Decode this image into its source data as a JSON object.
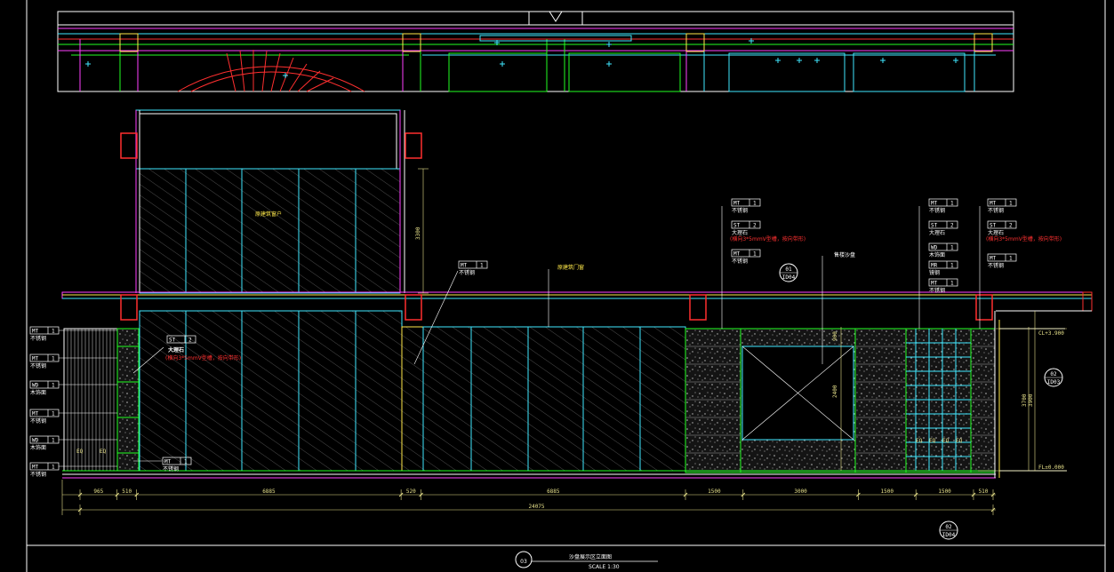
{
  "colors": {
    "background": "#000000",
    "frame": "#ffffff",
    "wall": "#ff2f2f",
    "magenta": "#ff3fff",
    "cyan": "#3fe8ff",
    "green": "#22ff22",
    "yellow": "#ffe94a",
    "dimension": "#e6e08a",
    "glass_hatch": "#6a6a6a"
  },
  "title_block": {
    "number": "03",
    "title": "沙盘展示区立面图",
    "scale": "SCALE 1:30"
  },
  "labels": {
    "window": "原建筑窗户",
    "door": "原建筑门窗",
    "sand_table": "售楼沙盘",
    "marble_bold": "大理石",
    "glass_note": "(横向3*5mmV型槽，按向带形)"
  },
  "tags_left": [
    {
      "code": "MT",
      "num": "1",
      "desc": "不锈钢"
    },
    {
      "code": "MT",
      "num": "1",
      "desc": "不锈钢"
    },
    {
      "code": "WD",
      "num": "1",
      "desc": "木饰面"
    },
    {
      "code": "MT",
      "num": "1",
      "desc": "不锈钢"
    },
    {
      "code": "WD",
      "num": "1",
      "desc": "木饰面"
    },
    {
      "code": "MT",
      "num": "1",
      "desc": "不锈钢"
    }
  ],
  "tag_st_left": {
    "code": "ST",
    "num": "2"
  },
  "tag_mid_top": {
    "code": "MT",
    "num": "1",
    "desc": "不锈钢"
  },
  "tag_mid_bottom": {
    "code": "MT",
    "num": "1",
    "desc": "不锈钢"
  },
  "tags_right_a": [
    {
      "code": "MT",
      "num": "1",
      "desc": "不锈钢"
    },
    {
      "code": "ST",
      "num": "2",
      "desc": "大理石",
      "note": "(横向3*5mmV型槽，按向带形)"
    },
    {
      "code": "MT",
      "num": "1",
      "desc": "不锈钢"
    }
  ],
  "tags_right_b": [
    {
      "code": "MT",
      "num": "1",
      "desc": "不锈钢"
    },
    {
      "code": "ST",
      "num": "2",
      "desc": "大理石"
    },
    {
      "code": "WD",
      "num": "1",
      "desc": "木饰面"
    },
    {
      "code": "MR",
      "num": "1",
      "desc": "镜钢"
    },
    {
      "code": "MT",
      "num": "1",
      "desc": "不锈钢"
    }
  ],
  "tags_right_c": [
    {
      "code": "MT",
      "num": "1",
      "desc": "不锈钢"
    },
    {
      "code": "ST",
      "num": "2",
      "desc": "大理石",
      "note": "(横向3*5mmV型槽，按向带形)"
    },
    {
      "code": "MT",
      "num": "1",
      "desc": "不锈钢"
    }
  ],
  "section_markers": [
    {
      "num": "01",
      "ref": "ID04"
    },
    {
      "num": "02",
      "ref": "ID03"
    },
    {
      "num": "02",
      "ref": "ID04"
    }
  ],
  "levels": {
    "ceiling": "CL+3.900",
    "floor": "FL±0.000"
  },
  "vertical_dims": {
    "upper": "3300",
    "mid": "2400",
    "right_a": "3700",
    "right_b": "3900",
    "top": "900"
  },
  "dimensions": [
    {
      "label": "965",
      "mm": 965
    },
    {
      "label": "510",
      "mm": 510
    },
    {
      "label": "6885",
      "mm": 6885
    },
    {
      "label": "520",
      "mm": 520
    },
    {
      "label": "6885",
      "mm": 6885
    },
    {
      "label": "1500",
      "mm": 1500
    },
    {
      "label": "3000",
      "mm": 3000
    },
    {
      "label": "1500",
      "mm": 1500
    },
    {
      "label": "1500",
      "mm": 1500
    },
    {
      "label": "510",
      "mm": 510
    }
  ],
  "total_dimension": "24075",
  "eq_labels": [
    "EQ",
    "EQ",
    "EQ",
    "EQ",
    "EQ",
    "EQ"
  ]
}
